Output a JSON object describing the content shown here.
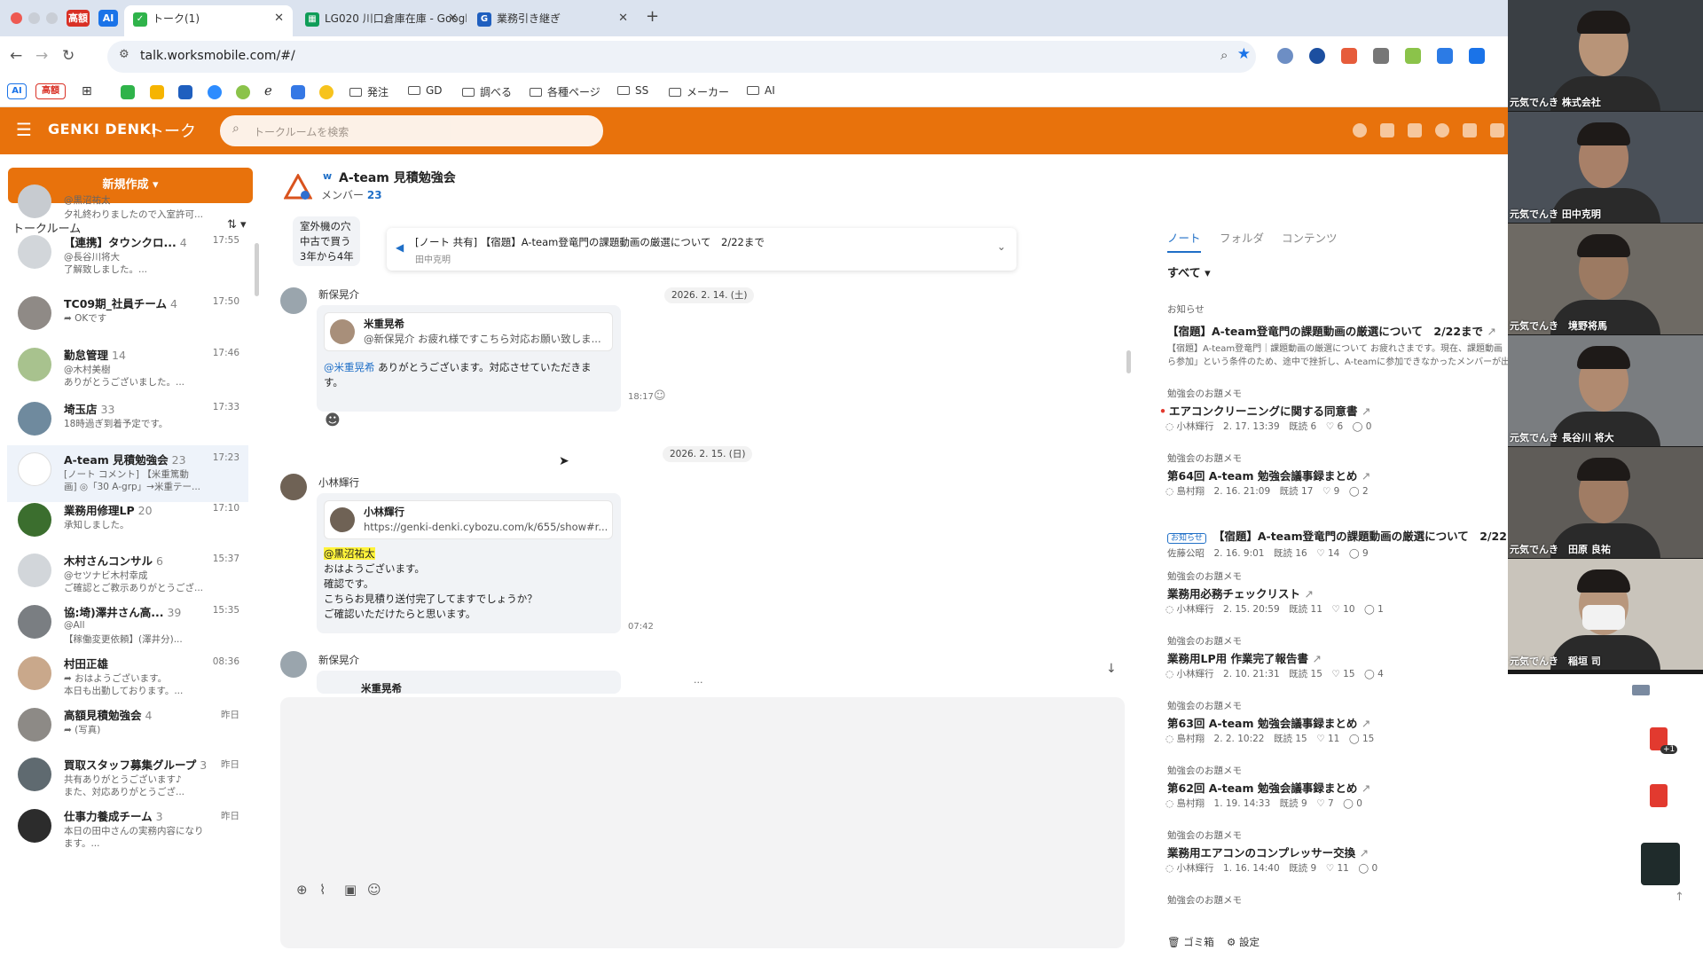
{
  "browser": {
    "pinned": [
      "高額",
      "AI"
    ],
    "tabs": [
      {
        "title": "トーク(1)",
        "active": true
      },
      {
        "title": "LG020 川口倉庫在庫 - Googl",
        "active": false
      },
      {
        "title": "業務引き継ぎ",
        "active": false
      }
    ],
    "new_tab": "+",
    "url": "talk.worksmobile.com/#/",
    "bookmark_badges": [
      "AI",
      "高額"
    ],
    "bookmarks": [
      "発注",
      "GD",
      "調べる",
      "各種ページ",
      "SS",
      "メーカー",
      "AI"
    ]
  },
  "app": {
    "brand": "GENKI DENKI",
    "section": "トーク",
    "search_placeholder": "トークルームを検索",
    "accent": "#e8720c"
  },
  "left": {
    "new_button": "新規作成 ▾",
    "room_header": "トークルーム",
    "sort_icon": "⇅ ▾",
    "rooms": [
      {
        "name": "",
        "count": "",
        "time": "",
        "line1": "@黒沼祐太",
        "line2": "夕礼終わりましたので入室許可..."
      },
      {
        "name": "【連携】タウンクロ...",
        "count": "4",
        "time": "17:55",
        "line1": "@長谷川将大",
        "line2": "了解致しました。..."
      },
      {
        "name": "TC09期_社員チーム",
        "count": "4",
        "time": "17:50",
        "line1": "➦ OKです",
        "line2": ""
      },
      {
        "name": "勤怠管理",
        "count": "14",
        "time": "17:46",
        "line1": "@木村美樹",
        "line2": "ありがとうございました。..."
      },
      {
        "name": "埼玉店",
        "count": "33",
        "time": "17:33",
        "line1": "18時過ぎ到着予定です。",
        "line2": ""
      },
      {
        "name": "A-team 見積勉強会",
        "count": "23",
        "time": "17:23",
        "line1": "[ノート コメント] 【米重篤動",
        "line2": "画] ◎「30 A-grp」→米重テー..."
      },
      {
        "name": "業務用修理LP",
        "count": "20",
        "time": "17:10",
        "line1": "承知しました。",
        "line2": ""
      },
      {
        "name": "木村さんコンサル",
        "count": "6",
        "time": "15:37",
        "line1": "@セツナビ木村幸成",
        "line2": "ご確認とご教示ありがとうござ..."
      },
      {
        "name": "協:埼)澤井さん高...",
        "count": "39",
        "time": "15:35",
        "line1": "@All",
        "line2": "【稼働変更依頼】(澤井分)..."
      },
      {
        "name": "村田正雄",
        "count": "",
        "time": "08:36",
        "line1": "➦ おはようございます。",
        "line2": "本日も出勤しております。..."
      },
      {
        "name": "高額見積勉強会",
        "count": "4",
        "time": "昨日",
        "line1": "➦ (写真)",
        "line2": ""
      },
      {
        "name": "買取スタッフ募集グループ",
        "count": "3",
        "time": "昨日",
        "line1": "共有ありがとうございます♪",
        "line2": "また、対応ありがとうござ..."
      },
      {
        "name": "仕事力養成チーム",
        "count": "3",
        "time": "昨日",
        "line1": "本日の田中さんの実務内容になり",
        "line2": "ます。..."
      }
    ]
  },
  "chat": {
    "title": "A-team 見積勉強会",
    "members_label": "メンバー",
    "members_count": "23",
    "pinned_title": "[ノート 共有] 【宿題】A-team登竜門の課題動画の厳選について　2/22まで",
    "pinned_sub": "田中克明",
    "behind1": "室外機の穴",
    "behind2": "中古で買う",
    "behind3": "3年から4年",
    "date1": "2026. 2. 14. (土)",
    "date2": "2026. 2. 15. (日)",
    "msg1": {
      "sender": "新保晃介",
      "quote_name": "米重晃希",
      "quote_text": "@新保晃介 お疲れ様ですこちら対応お願い致しま...",
      "mention": "@米重晃希",
      "text1": " ありがとうございます。対応させていただきま",
      "text2": "す。",
      "time": "18:17"
    },
    "msg2": {
      "sender": "小林輝行",
      "quote_name": "小林輝行",
      "quote_text": "https://genki-denki.cybozu.com/k/655/show#r...",
      "mention": "@黒沼祐太",
      "lines": [
        "おはようございます。",
        "確認です。",
        "こちらお見積り送付完了してますでしょうか？",
        "ご確認いただけたらと思います。"
      ],
      "time": "07:42"
    },
    "msg3": {
      "sender": "新保晃介",
      "partial": "米重晃希"
    },
    "more": "...",
    "scroll_down": "↓"
  },
  "right": {
    "tabs": [
      "ノート",
      "フォルダ",
      "コンテンツ"
    ],
    "filter": "すべて ▾",
    "notice_cat": "お知らせ",
    "notice_title": "【宿題】A-team登竜門の課題動画の厳選について　2/22まで",
    "notice_body1": "【宿題】A-team登竜門｜課題動画の厳選について お疲れさまです。現在、課題動画",
    "notice_body2": "ら参加」という条件のため、途中で挫折し、A-teamに参加できなかったメンバーが出",
    "notes": [
      {
        "cat": "勉強会のお題メモ",
        "title": "エアコンクリーニングに関する同意書",
        "author": "小林輝行",
        "date": "2. 17. 13:39",
        "read": "既読 6",
        "likes": "6",
        "comments": "0",
        "dot": true
      },
      {
        "cat": "勉強会のお題メモ",
        "title": "第64回 A-team 勉強会議事録まとめ",
        "author": "島村翔",
        "date": "2. 16. 21:09",
        "read": "既読 17",
        "likes": "9",
        "comments": "2",
        "dot": false
      },
      {
        "cat": "お知らせ",
        "title": "【宿題】A-team登竜門の課題動画の厳選について　2/22まで",
        "author": "佐藤公昭",
        "date": "2. 16. 9:01",
        "read": "既読 16",
        "likes": "14",
        "comments": "9",
        "dot": false,
        "badge": true
      },
      {
        "cat": "勉強会のお題メモ",
        "title": "業務用必務チェックリスト",
        "author": "小林輝行",
        "date": "2. 15. 20:59",
        "read": "既読 11",
        "likes": "10",
        "comments": "1",
        "dot": false
      },
      {
        "cat": "勉強会のお題メモ",
        "title": "業務用LP用 作業完了報告書",
        "author": "小林輝行",
        "date": "2. 10. 21:31",
        "read": "既読 15",
        "likes": "15",
        "comments": "4",
        "dot": false
      },
      {
        "cat": "勉強会のお題メモ",
        "title": "第63回 A-team 勉強会議事録まとめ",
        "author": "島村翔",
        "date": "2. 2. 10:22",
        "read": "既読 15",
        "likes": "11",
        "comments": "15",
        "dot": false
      },
      {
        "cat": "勉強会のお題メモ",
        "title": "第62回 A-team 勉強会議事録まとめ",
        "author": "島村翔",
        "date": "1. 19. 14:33",
        "read": "既読 9",
        "likes": "7",
        "comments": "0",
        "dot": false
      },
      {
        "cat": "勉強会のお題メモ",
        "title": "業務用エアコンのコンプレッサー交換",
        "author": "小林輝行",
        "date": "1. 16. 14:40",
        "read": "既読 9",
        "likes": "11",
        "comments": "0",
        "dot": false
      },
      {
        "cat": "勉強会のお題メモ",
        "title": "",
        "author": "",
        "date": "",
        "read": "",
        "likes": "",
        "comments": "",
        "dot": false
      }
    ],
    "trash": "ゴミ箱",
    "settings": "設定"
  },
  "video": {
    "participants": [
      "元気でんき 株式会社",
      "元気でんき 田中克明",
      "元気でんき　境野将馬",
      "元気でんき 長谷川 将大",
      "元気でんき　田原 良祐",
      "元気でんき　稲垣 司"
    ]
  },
  "side_icons": {
    "pdf_badge": "+1"
  }
}
